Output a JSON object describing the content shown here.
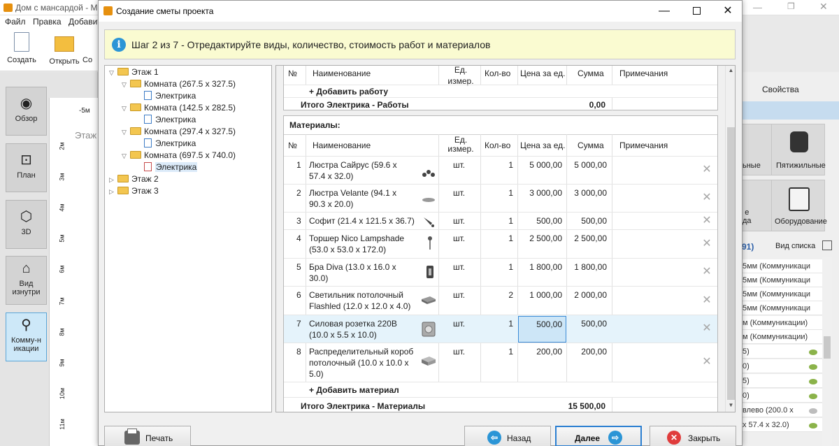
{
  "background_app": {
    "title": "Дом с мансардой - Мо",
    "menu": [
      "Файл",
      "Правка",
      "Добавит"
    ],
    "toolbar": [
      {
        "label": "Создать",
        "icon": "new-file-icon"
      },
      {
        "label": "Открыть",
        "icon": "open-folder-icon"
      },
      {
        "label": "Со",
        "icon": "save-icon"
      }
    ],
    "nav": [
      {
        "label": "Обзор",
        "icon": "eye-icon"
      },
      {
        "label": "План",
        "icon": "plan-icon"
      },
      {
        "label": "3D",
        "icon": "cube-icon"
      },
      {
        "label": "Вид изнутри",
        "icon": "interior-view-icon"
      },
      {
        "label": "Комму-никации",
        "icon": "faucet-icon",
        "active": true
      }
    ],
    "stage_label": "Этаж",
    "ruler_top": "-5м",
    "ruler_left": [
      "2м",
      "3м",
      "4м",
      "5м",
      "6м",
      "7м",
      "8м",
      "9м",
      "10м",
      "11м"
    ],
    "right_panel": {
      "tab": "Свойства",
      "tiles": [
        "ьные",
        "Пятижильные",
        "е\nда",
        "Оборудование"
      ],
      "list_header_count": "91)",
      "list_view_label": "Вид списка",
      "rows": [
        "5мм (Коммуникаци",
        "5мм (Коммуникаци",
        "5мм (Коммуникаци",
        "5мм (Коммуникаци",
        "м (Коммуникации)",
        "м (Коммуникации)",
        "5)",
        "0)",
        "5)",
        "0)",
        "влево (200.0 x",
        "x 57.4 x 32.0)"
      ]
    }
  },
  "dialog": {
    "title": "Создание сметы проекта",
    "banner": "Шаг 2 из 7 - Отредактируйте виды, количество, стоимость работ и материалов",
    "tree": [
      {
        "label": "Этаж 1",
        "level": 0,
        "expanded": true,
        "type": "folder"
      },
      {
        "label": "Комната (267.5 x 327.5)",
        "level": 1,
        "expanded": true,
        "type": "folder"
      },
      {
        "label": "Электрика",
        "level": 2,
        "type": "doc"
      },
      {
        "label": "Комната (142.5 x 282.5)",
        "level": 1,
        "expanded": true,
        "type": "folder"
      },
      {
        "label": "Электрика",
        "level": 2,
        "type": "doc"
      },
      {
        "label": "Комната (297.4 x 327.5)",
        "level": 1,
        "expanded": true,
        "type": "folder"
      },
      {
        "label": "Электрика",
        "level": 2,
        "type": "doc"
      },
      {
        "label": "Комната (697.5 x 740.0)",
        "level": 1,
        "expanded": true,
        "type": "folder"
      },
      {
        "label": "Электрика",
        "level": 2,
        "type": "doc",
        "selected": true
      },
      {
        "label": "Этаж 2",
        "level": 0,
        "expanded": false,
        "type": "folder"
      },
      {
        "label": "Этаж 3",
        "level": 0,
        "expanded": false,
        "type": "folder"
      }
    ],
    "works": {
      "columns": [
        "№",
        "Наименование",
        "Ед. измер.",
        "Кол-во",
        "Цена за ед.",
        "Сумма",
        "Примечания"
      ],
      "add_label": "+ Добавить работу",
      "total_label": "Итого Электрика - Работы",
      "total_value": "0,00"
    },
    "materials": {
      "section_title": "Материалы:",
      "columns": [
        "№",
        "Наименование",
        "Ед.\nизмер.",
        "Кол-во",
        "Цена за ед.",
        "Сумма",
        "Примечания"
      ],
      "rows": [
        {
          "no": "1",
          "name": "Люстра Сайрус (59.6 x 57.4 x 32.0)",
          "unit": "шт.",
          "qty": "1",
          "price": "5 000,00",
          "sum": "5 000,00",
          "icon": "chandelier-icon"
        },
        {
          "no": "2",
          "name": "Люстра Velante (94.1 x 90.3 x 20.0)",
          "unit": "шт.",
          "qty": "1",
          "price": "3 000,00",
          "sum": "3 000,00",
          "icon": "chandelier-flat-icon"
        },
        {
          "no": "3",
          "name": "Софит (21.4 x 121.5 x 36.7)",
          "unit": "шт.",
          "qty": "1",
          "price": "500,00",
          "sum": "500,00",
          "icon": "spotlight-icon"
        },
        {
          "no": "4",
          "name": "Торшер Nico Lampshade (53.0 x 53.0 x 172.0)",
          "unit": "шт.",
          "qty": "1",
          "price": "2 500,00",
          "sum": "2 500,00",
          "icon": "floor-lamp-icon"
        },
        {
          "no": "5",
          "name": "Бра Diva (13.0 x 16.0 x 30.0)",
          "unit": "шт.",
          "qty": "1",
          "price": "1 800,00",
          "sum": "1 800,00",
          "icon": "wall-lamp-icon"
        },
        {
          "no": "6",
          "name": "Светильник потолочный Flashled (12.0 x 12.0 x 4.0)",
          "unit": "шт.",
          "qty": "2",
          "price": "1 000,00",
          "sum": "2 000,00",
          "icon": "ceiling-light-icon"
        },
        {
          "no": "7",
          "name": "Силовая розетка 220В (10.0 x 5.5 x 10.0)",
          "unit": "шт.",
          "qty": "1",
          "price": "500,00",
          "sum": "500,00",
          "icon": "power-socket-icon",
          "selected": true
        },
        {
          "no": "8",
          "name": "Распределительный короб потолочный (10.0 x 10.0 x 5.0)",
          "unit": "шт.",
          "qty": "1",
          "price": "200,00",
          "sum": "200,00",
          "icon": "junction-box-icon"
        }
      ],
      "add_label": "+ Добавить материал",
      "total_label": "Итого Электрика - Материалы",
      "total_value": "15 500,00"
    },
    "buttons": {
      "print": "Печать",
      "back": "Назад",
      "next": "Далее",
      "close": "Закрыть"
    }
  },
  "colors": {
    "banner_bg": "#fafbd1",
    "selection": "#e5f3fb",
    "accent_blue": "#2b95d6",
    "close_red": "#e03c3c"
  }
}
